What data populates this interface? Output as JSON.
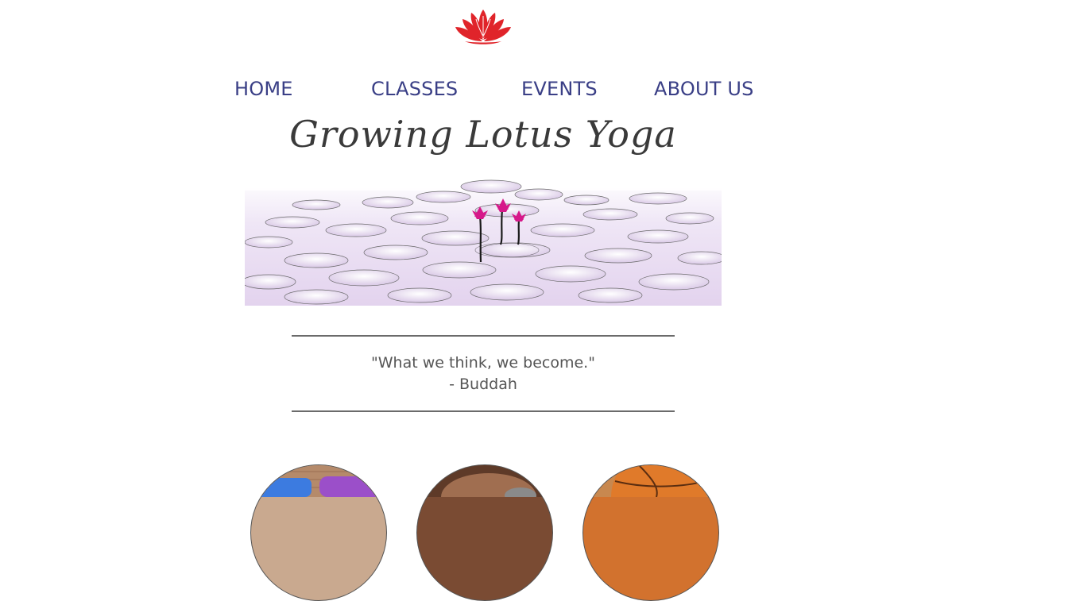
{
  "logo": {
    "icon": "lotus-icon",
    "color": "#e0242a"
  },
  "nav": {
    "items": [
      {
        "label": "HOME"
      },
      {
        "label": "CLASSES"
      },
      {
        "label": "EVENTS"
      },
      {
        "label": "ABOUT US"
      }
    ],
    "color": "#3a3f86"
  },
  "banner": {
    "title": "Growing Lotus Yoga"
  },
  "quote": {
    "text": "\"What we think, we become.\"",
    "author": "- Buddah"
  },
  "feature_images": [
    {
      "name": "yoga-mats-image"
    },
    {
      "name": "meditation-image"
    },
    {
      "name": "basketball-image"
    }
  ]
}
